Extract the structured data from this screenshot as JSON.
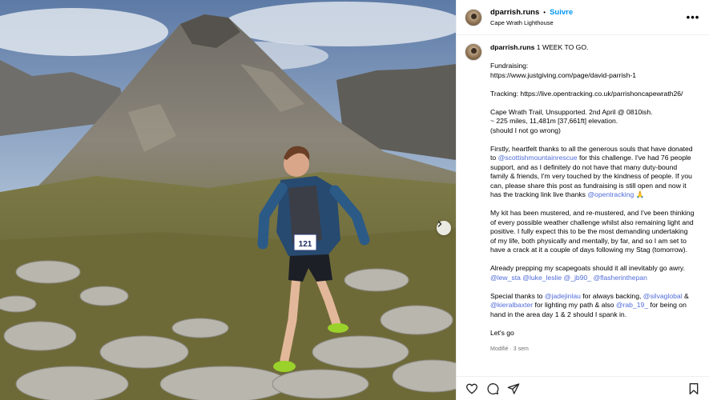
{
  "header": {
    "username": "dparrish.runs",
    "separator": "•",
    "follow_label": "Suivre",
    "location": "Cape Wrath Lighthouse",
    "more_label": "•••"
  },
  "caption": {
    "username": "dparrish.runs",
    "title": "1 WEEK TO GO.",
    "fundraising_label": "Fundraising:",
    "fundraising_url": "https://www.justgiving.com/page/david-parrish-1",
    "tracking_text": "Tracking: https://live.opentracking.co.uk/parrishoncapewrath26/",
    "trail_line1": "Cape Wrath Trail, Unsupported. 2nd April @ 0810ish.",
    "trail_line2": "~ 225 miles, 11,481m [37,661ft] elevation.",
    "trail_line3": "(should I not go wrong)",
    "thanks_part1": "Firstly, heartfelt thanks to all the generous souls that have donated to ",
    "thanks_mention": "@scottishmountainrescue",
    "thanks_part2": " for this challenge. I've had 76 people support, and as I definitely do not have that many duty-bound family & friends, I'm very touched by the kindness of people. If you can, please share this post as fundraising is still open and now it has the tracking link live thanks ",
    "thanks_mention2": "@opentracking",
    "thanks_emoji": "🙏",
    "kit_text": "My kit has been mustered, and re-mustered, and I've been thinking of every possible weather challenge whilst also remaining light and positive. I fully expect this to be the most demanding undertaking of my life, both physically and mentally, by far, and so I am set to have a crack at it a couple of days following my Stag (tomorrow).",
    "scapegoats_text": "Already prepping my scapegoats should it all inevitably go awry. ",
    "scapegoat_mentions": [
      "@lew_sta",
      "@luke_leslie",
      "@_jb90_",
      "@flasherinthepan"
    ],
    "special_part1": "Special thanks to ",
    "special_m1": "@jadejinlau",
    "special_part2": " for always backing, ",
    "special_m2": "@silvaglobal",
    "special_part3": " & ",
    "special_m3": "@kieralbaxter",
    "special_part4": " for lighting my path & also ",
    "special_m4": "@rab_19_",
    "special_part5": " for being on hand in the area day 1 & 2 should I spank in.",
    "signoff": "Let's go",
    "meta": "Modifié · 3 sem"
  },
  "photo": {
    "bib_number": "121"
  },
  "icons": {
    "like": "heart-icon",
    "comment": "comment-icon",
    "share": "share-icon",
    "save": "bookmark-icon",
    "next": "chevron-right-icon"
  }
}
